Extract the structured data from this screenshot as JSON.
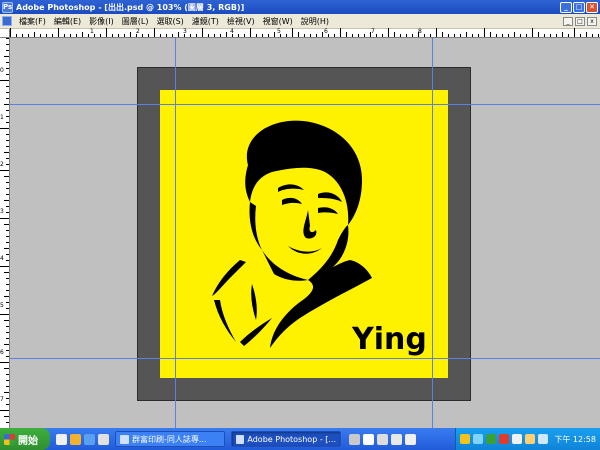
{
  "window": {
    "title": "Adobe Photoshop - [出出.psd @ 103% (圖層 3, RGB)]",
    "icon": "Ps",
    "minimize": "_",
    "maximize": "□",
    "close": "✕"
  },
  "menu": {
    "items": [
      "檔案(F)",
      "編輯(E)",
      "影像(I)",
      "圖層(L)",
      "選取(S)",
      "濾鏡(T)",
      "檢視(V)",
      "視窗(W)",
      "說明(H)"
    ],
    "doc_min": "_",
    "doc_max": "□",
    "doc_close": "x"
  },
  "rulers": {
    "top": [
      "1",
      "2",
      "3",
      "4",
      "5",
      "6",
      "7",
      "8"
    ],
    "left": [
      "0",
      "1",
      "2",
      "3",
      "4",
      "5",
      "6",
      "7"
    ]
  },
  "canvas": {
    "signature": "Ying",
    "background_color": "#fff200",
    "frame_color": "#555555"
  },
  "taskbar": {
    "start_label": "開始",
    "tasks": [
      {
        "label": "群富印刷-同人誌專...",
        "active": false
      },
      {
        "label": "Adobe Photoshop - [...",
        "active": true
      }
    ],
    "clock": "下午 12:58"
  }
}
